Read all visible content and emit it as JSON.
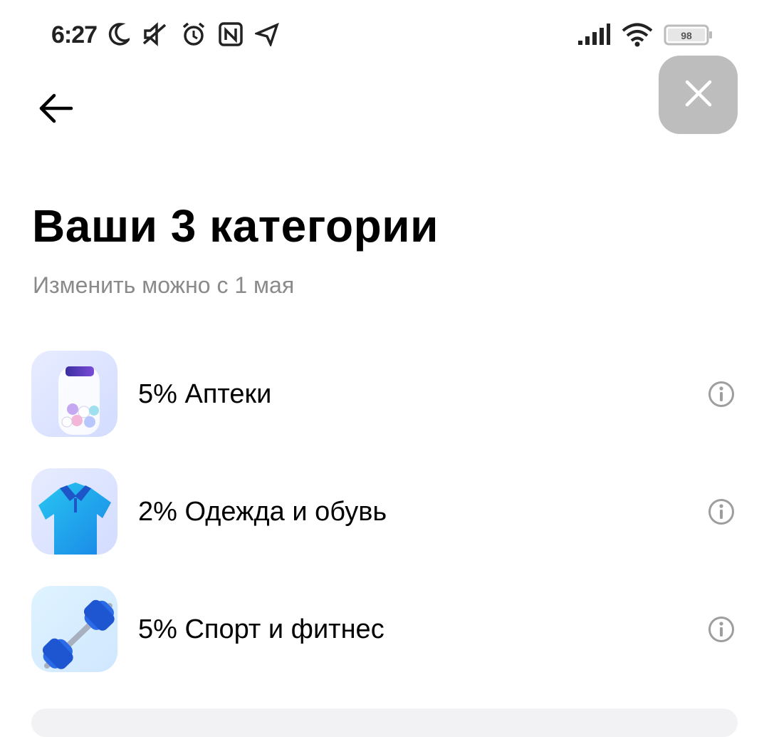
{
  "status_bar": {
    "time": "6:27",
    "battery_level": "98"
  },
  "header": {
    "back_icon": "arrow-left-icon",
    "close_icon": "close-icon"
  },
  "title": "Ваши 3 категории",
  "subtitle": "Изменить можно с 1 мая",
  "categories": [
    {
      "label": "5% Аптеки",
      "icon": "pill-bottle-icon",
      "info_icon": "info-icon"
    },
    {
      "label": "2% Одежда и обувь",
      "icon": "polo-shirt-icon",
      "info_icon": "info-icon"
    },
    {
      "label": "5% Спорт и фитнес",
      "icon": "dumbbell-icon",
      "info_icon": "info-icon"
    }
  ],
  "colors": {
    "close_button_bg": "#bdbdbd",
    "subtitle": "#8a8a8a",
    "info_icon": "#9e9e9e"
  }
}
